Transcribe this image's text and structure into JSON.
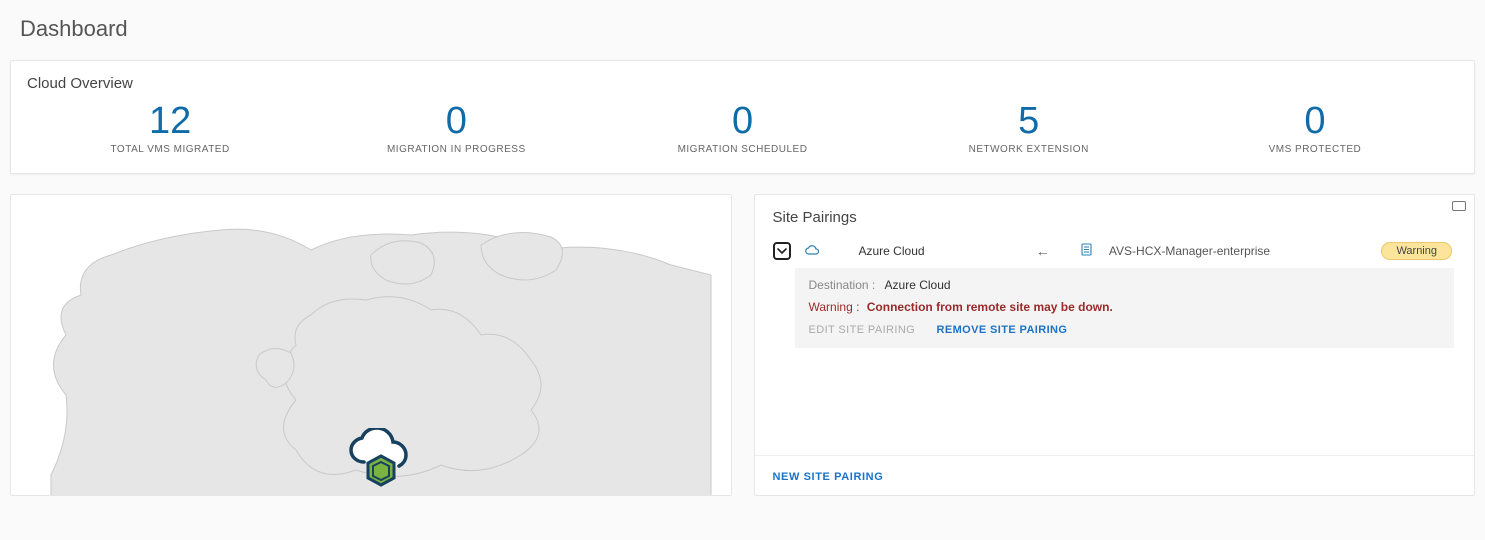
{
  "page_title": "Dashboard",
  "overview": {
    "title": "Cloud Overview",
    "stats": [
      {
        "value": "12",
        "label": "TOTAL VMS MIGRATED"
      },
      {
        "value": "0",
        "label": "MIGRATION IN PROGRESS"
      },
      {
        "value": "0",
        "label": "MIGRATION SCHEDULED"
      },
      {
        "value": "5",
        "label": "NETWORK EXTENSION"
      },
      {
        "value": "0",
        "label": "VMS PROTECTED"
      }
    ]
  },
  "site_pairings": {
    "title": "Site Pairings",
    "new_label": "NEW SITE PAIRING",
    "entries": [
      {
        "source_name": "Azure Cloud",
        "destination_name": "AVS-HCX-Manager-enterprise",
        "status_badge": "Warning",
        "detail": {
          "destination_label": "Destination :",
          "destination_value": "Azure Cloud",
          "warning_label": "Warning :",
          "warning_message": "Connection from remote site may be down.",
          "edit_label": "EDIT SITE PAIRING",
          "remove_label": "REMOVE SITE PAIRING"
        }
      }
    ]
  }
}
